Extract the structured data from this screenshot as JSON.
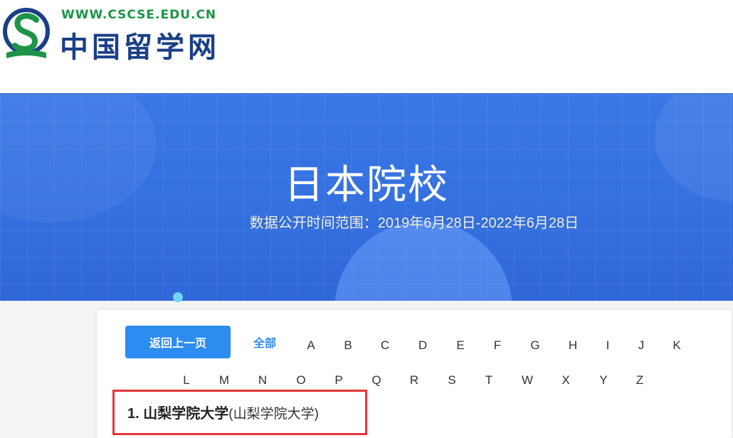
{
  "header": {
    "site_url": "WWW.CSCSE.EDU.CN",
    "site_name": "中国留学网",
    "logo_icon": "cscse-logo-icon",
    "colors": {
      "url_green": "#1d9448",
      "name_blue": "#1a3f88"
    }
  },
  "banner": {
    "title": "日本院校",
    "subtitle": "数据公开时间范围：2019年6月28日-2022年6月28日",
    "colors": {
      "background": "#3470e0",
      "subtitle": "#f2efd8"
    }
  },
  "filter_panel": {
    "back_label": "返回上一页",
    "all_label": "全部",
    "letters_row1": [
      "A",
      "B",
      "C",
      "D",
      "E",
      "F",
      "G",
      "H",
      "I",
      "J",
      "K"
    ],
    "letters_row2": [
      "L",
      "M",
      "N",
      "O",
      "P",
      "Q",
      "R",
      "S",
      "T",
      "W",
      "X",
      "Y",
      "Z"
    ],
    "colors": {
      "accent": "#2d8cf0"
    }
  },
  "results": [
    {
      "index": "1.",
      "name": "山梨学院大学",
      "alt": "(山梨学院大学)"
    }
  ],
  "highlight_color": "#e5353b"
}
